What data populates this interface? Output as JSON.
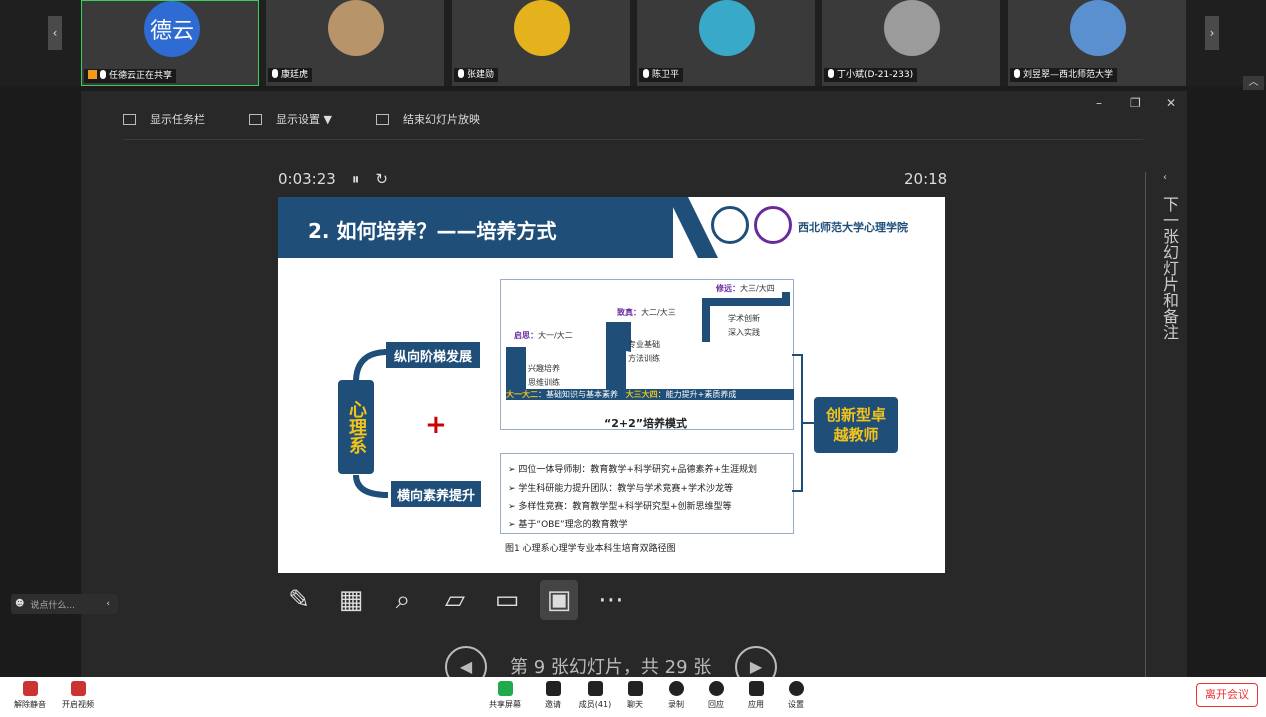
{
  "participants": [
    {
      "avatar_text": "德云",
      "name": "任德云正在共享",
      "sharing": true
    },
    {
      "name": "康廷虎"
    },
    {
      "name": "张建勋"
    },
    {
      "name": "陈卫平"
    },
    {
      "name": "丁小斌(D-21-233)"
    },
    {
      "name": "刘昱翠—西北师范大学"
    }
  ],
  "controls": {
    "taskbar": "显示任务栏",
    "display_settings": "显示设置 ▼",
    "end_show": "结束幻灯片放映"
  },
  "timer": "0:03:23",
  "clock": "20:18",
  "slide": {
    "title": "2. 如何培养？——培养方式",
    "university": "西北师范大学心理学院",
    "left_box": "心理系",
    "plus": "+",
    "vertical_box": "纵向阶梯发展",
    "horizontal_box": "横向素养提升",
    "outcome_box": "创新型卓越教师",
    "stage1_label": "启思：",
    "stage1_val": "大一/大二",
    "stage2_label": "致真：",
    "stage2_val": "大二/大三",
    "stage3_label": "修远：",
    "stage3_val": "大三/大四",
    "stage1_desc": [
      "兴趣培养",
      "思维训练"
    ],
    "stage2_desc": [
      "专业基础",
      "方法训练"
    ],
    "stage3_desc": [
      "学术创新",
      "深入实践"
    ],
    "bar_left_a": "大一大二",
    "bar_left_b": "：基础知识与基本素养",
    "bar_right_a": "大三大四",
    "bar_right_b": "：能力提升+素质养成",
    "model": "“2+2”培养模式",
    "bullets": [
      "四位一体导师制：教育教学+科学研究+品德素养+生涯规划",
      "学生科研能力提升团队：教学与学术竞赛+学术沙龙等",
      "多样性竞赛：教育教学型+科学研究型+创新思维型等",
      "基于“OBE”理念的教育教学"
    ],
    "caption": "图1 心理系心理学专业本科生培育双路径图"
  },
  "nav": {
    "text": "第 9 张幻灯片，共 29 张"
  },
  "side_label": "下一张幻灯片和备注",
  "chat_placeholder": "说点什么...",
  "bottom": {
    "mute": "解除静音",
    "video": "开启视频",
    "share": "共享屏幕",
    "invite": "邀请",
    "members": "成员(41)",
    "chat": "聊天",
    "record": "录制",
    "react": "回应",
    "apps": "应用",
    "settings": "设置",
    "leave": "离开会议"
  },
  "colors": {
    "slide_blue": "#1f4e79",
    "active_border": "#3ccf5e",
    "leave_red": "#ee3333"
  }
}
